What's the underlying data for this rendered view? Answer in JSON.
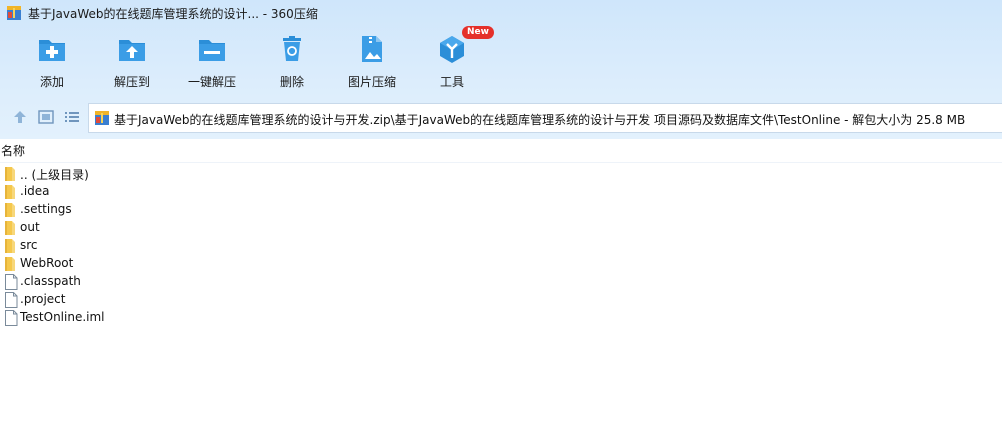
{
  "window": {
    "title": "基于JavaWeb的在线题库管理系统的设计... - 360压缩"
  },
  "toolbar": {
    "buttons": [
      {
        "label": "添加",
        "icon": "add-icon"
      },
      {
        "label": "解压到",
        "icon": "extract-to-icon"
      },
      {
        "label": "一键解压",
        "icon": "one-click-extract-icon"
      },
      {
        "label": "删除",
        "icon": "delete-icon"
      },
      {
        "label": "图片压缩",
        "icon": "image-compress-icon"
      },
      {
        "label": "工具",
        "icon": "tools-icon",
        "badge": "New"
      }
    ]
  },
  "path": {
    "text": "基于JavaWeb的在线题库管理系统的设计与开发.zip\\基于JavaWeb的在线题库管理系统的设计与开发 项目源码及数据库文件\\TestOnline - 解包大小为 25.8 MB"
  },
  "list": {
    "column_name": "名称",
    "items": [
      {
        "name": ".. (上级目录)",
        "type": "folder"
      },
      {
        "name": ".idea",
        "type": "folder"
      },
      {
        "name": ".settings",
        "type": "folder"
      },
      {
        "name": "out",
        "type": "folder"
      },
      {
        "name": "src",
        "type": "folder"
      },
      {
        "name": "WebRoot",
        "type": "folder"
      },
      {
        "name": ".classpath",
        "type": "file"
      },
      {
        "name": ".project",
        "type": "file"
      },
      {
        "name": "TestOnline.iml",
        "type": "file"
      }
    ]
  },
  "colors": {
    "accent": "#2b8ed8",
    "folder": "#f5c84c",
    "badge": "#e5302a"
  }
}
